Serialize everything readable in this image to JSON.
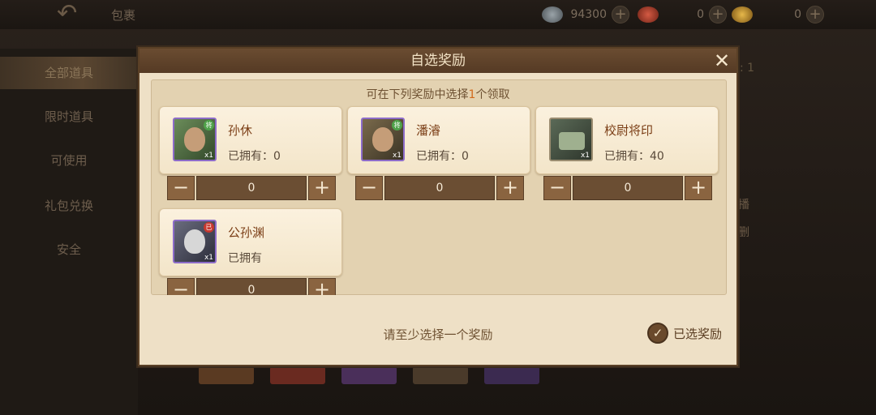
{
  "header": {
    "title": "包裹",
    "resources": [
      {
        "icon": "silver-coin-icon",
        "value": "94300"
      },
      {
        "icon": "red-ingot-icon",
        "value": "0"
      },
      {
        "icon": "gold-ingot-icon",
        "value": "0"
      }
    ]
  },
  "sidebar": {
    "items": [
      {
        "label": "全部道具",
        "active": true
      },
      {
        "label": "限时道具"
      },
      {
        "label": "可使用"
      },
      {
        "label": "礼包兑换"
      },
      {
        "label": "安全"
      }
    ]
  },
  "background_fragments": {
    "right_top": ": 1",
    "right_mid_1": "播",
    "right_mid_2": "删"
  },
  "modal": {
    "title": "自选奖励",
    "subtitle_prefix": "可在下列奖励中选择",
    "subtitle_count": "1",
    "subtitle_suffix": "个领取",
    "cards": [
      {
        "name": "孙休",
        "owned": "已拥有：0",
        "qty_badge": "x1",
        "tag": "将",
        "count": "0"
      },
      {
        "name": "潘濬",
        "owned": "已拥有：0",
        "qty_badge": "x1",
        "tag": "将",
        "count": "0"
      },
      {
        "name": "校尉将印",
        "owned": "已拥有：40",
        "qty_badge": "x1",
        "tag": "",
        "count": "0"
      },
      {
        "name": "公孙渊",
        "owned": "已拥有",
        "qty_badge": "x1",
        "tag": "已",
        "count": "0"
      }
    ],
    "footer_hint": "请至少选择一个奖励",
    "selected_label": "已选奖励"
  }
}
